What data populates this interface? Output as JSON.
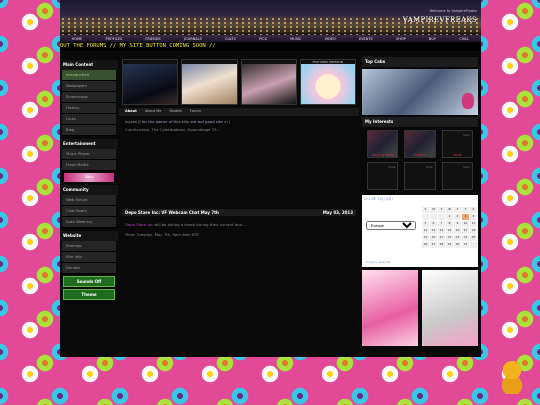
{
  "site": {
    "brand": "VAMPIREVFREAKS",
    "brand_sub": "Welcome to VampireFreaks"
  },
  "nav": [
    "HOME",
    "PROFILES",
    "FRIENDS",
    "JOURNALS",
    "CULTS",
    "PICS",
    "MUSIC",
    "VIDEO",
    "EVENTS",
    "SHOP",
    "BUY",
    "CHILL"
  ],
  "marquee": "OUT THE FORUMS // MY SITE BUTTON COMING SOON //",
  "sidebar": {
    "main_content": "Main Content",
    "main_items": [
      "Introduction",
      "Wallpapers",
      "Screencaps",
      "History",
      "Links",
      "Blog"
    ],
    "entertainment": "Entertainment",
    "ent_items": [
      "Music Player",
      "Flash Media"
    ],
    "banner": "Dolly",
    "community": "Community",
    "comm_items": [
      "Web Forum",
      "Chat Room",
      "Auto Webring"
    ],
    "website": "Website",
    "web_items": [
      "Sitemap",
      "Site Info",
      "Donate"
    ],
    "sounds_btn": "Sounds Off",
    "theme_btn": "Theme"
  },
  "main": {
    "thumb_caps": [
      "",
      "",
      "",
      "FEATURED PREMIUM"
    ],
    "tabs": [
      "About",
      "About Me",
      "Models",
      "Forum"
    ],
    "bio_line1": "Icycas // for the owner of this silly out but good site >:)",
    "bio_line2": "Cumfunction, The Cyberbabeez, Assemblage 23...",
    "news_title": "Depo Stare Inc: VF Webcam Chat May 7th",
    "news_date": "May 03, 2013",
    "news_user": "Depo Stare Inc",
    "news_text": " will be taking a break during their current tour...",
    "news_time": "Time: Tuesday, May 7th, 9pm-6am EST"
  },
  "right": {
    "top_cabs": "Top Cabs",
    "interests": "My Interests",
    "interest_labels": [
      "HACK @ SHOP",
      "ARTIST",
      "SHOP",
      "",
      "",
      ""
    ],
    "interest_titles": [
      "",
      "",
      "none",
      "none",
      "none",
      "none"
    ],
    "calendar_title": "2013年 5月 (5月)",
    "calendar_region": "Europe",
    "calendar_days": [
      "S",
      "M",
      "T",
      "W",
      "T",
      "F",
      "S",
      "",
      "",
      "",
      "1",
      "2",
      "3",
      "4",
      "5",
      "6",
      "7",
      "8",
      "9",
      "10",
      "11",
      "12",
      "13",
      "14",
      "15",
      "16",
      "17",
      "18",
      "19",
      "20",
      "21",
      "22",
      "23",
      "24",
      "25",
      "26",
      "27",
      "28",
      "29",
      "30",
      "31",
      ""
    ],
    "calendar_foot": "today's calendar"
  },
  "colors": {
    "background": "#e24a98",
    "frame": "#090909",
    "marquee_text": "#f3e43a",
    "active_item": "#3a5030",
    "button_green": "#1e6a1e",
    "news_user": "#c03bd0"
  }
}
